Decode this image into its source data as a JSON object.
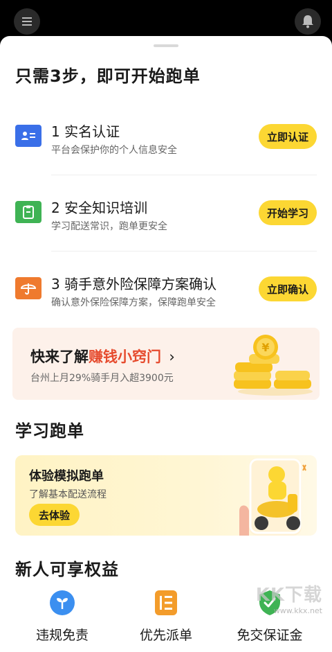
{
  "header": {
    "menu_icon": "menu-icon",
    "bell_icon": "bell-icon"
  },
  "main_title": "只需3步，即可开始跑单",
  "steps": [
    {
      "title": "1 实名认证",
      "subtitle": "平台会保护你的个人信息安全",
      "button": "立即认证",
      "icon": "id-card-icon",
      "color": "#3a6fe8"
    },
    {
      "title": "2 安全知识培训",
      "subtitle": "学习配送常识，跑单更安全",
      "button": "开始学习",
      "icon": "clipboard-icon",
      "color": "#3fb354"
    },
    {
      "title": "3 骑手意外险保障方案确认",
      "subtitle": "确认意外保险保障方案，保障跑单安全",
      "button": "立即确认",
      "icon": "umbrella-icon",
      "color": "#ef7a2e"
    }
  ],
  "promo": {
    "title_prefix": "快来了解",
    "title_highlight": "赚钱小窍门",
    "chevron": "›",
    "subtitle": "台州上月29%骑手月入超3900元",
    "image": "coin-stack-illustration"
  },
  "learn": {
    "section_title": "学习跑单",
    "card_title": "体验模拟跑单",
    "card_subtitle": "了解基本配送流程",
    "button": "去体验",
    "image": "rider-on-scooter-illustration"
  },
  "benefits": {
    "section_title": "新人可享权益",
    "items": [
      {
        "label": "违规免责",
        "icon": "sprout-icon",
        "color": "#3b8ff0"
      },
      {
        "label": "优先派单",
        "icon": "list-icon",
        "color": "#f39c2b"
      },
      {
        "label": "免交保证金",
        "icon": "shield-check-icon",
        "color": "#3fb354"
      }
    ]
  },
  "watermark": {
    "text": "KK下载",
    "url_text": "www.kkx.net"
  },
  "colors": {
    "accent_yellow": "#fcd733",
    "highlight_red": "#e64b2e",
    "promo_bg": "#fdf1ea"
  }
}
